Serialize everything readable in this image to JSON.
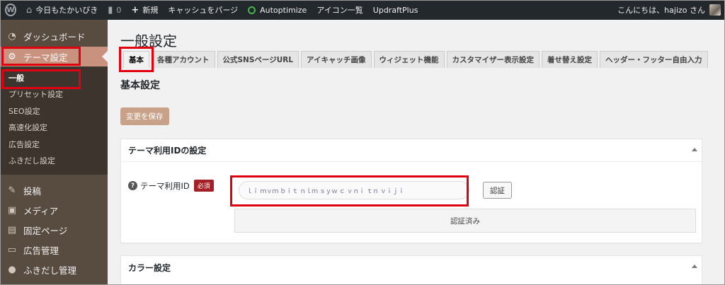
{
  "admin_bar": {
    "site_name": "今日もたかいびき",
    "comments_count": "0",
    "new_label": "新規",
    "purge_cache": "キャッシュをパージ",
    "autoptimize": "Autoptimize",
    "icon_list": "アイコン一覧",
    "updraftplus": "UpdraftPlus",
    "greeting": "こんにちは、hajizo さん"
  },
  "sidebar": {
    "dashboard": "ダッシュボード",
    "theme_settings": "テーマ設定",
    "submenu": [
      "一般",
      "プリセット設定",
      "SEO設定",
      "高速化設定",
      "広告設定",
      "ふきだし設定"
    ],
    "posts": "投稿",
    "media": "メディア",
    "pages": "固定ページ",
    "ad_management": "広告管理",
    "balloon_management": "ふきだし管理"
  },
  "main": {
    "page_title": "一般設定",
    "tabs": [
      "基本",
      "各種アカウント",
      "公式SNSページURL",
      "アイキャッチ画像",
      "ウィジェット機能",
      "カスタマイザー表示設定",
      "着せ替え設定",
      "ヘッダー・フッター自由入力"
    ],
    "section_heading": "基本設定",
    "save_button": "変更を保存",
    "theme_id_panel": {
      "title": "テーマ利用IDの設定",
      "label": "テーマ利用ID",
      "required_badge": "必須",
      "input_value": "ｌｉ ｍｖｍ ｂｉｔ ｎｌｍ ｓｙｗ ｃ ｖｎｉ ｔｎ ｖｉｊｉ",
      "auth_button": "認証",
      "status": "認証済み"
    },
    "color_panel": {
      "title": "カラー設定"
    }
  },
  "colors": {
    "highlight": "#e0000f",
    "sidebar_bg": "#584b40",
    "current_menu": "#c8927e",
    "save_button": "#c8a188",
    "required_badge": "#a32126"
  }
}
